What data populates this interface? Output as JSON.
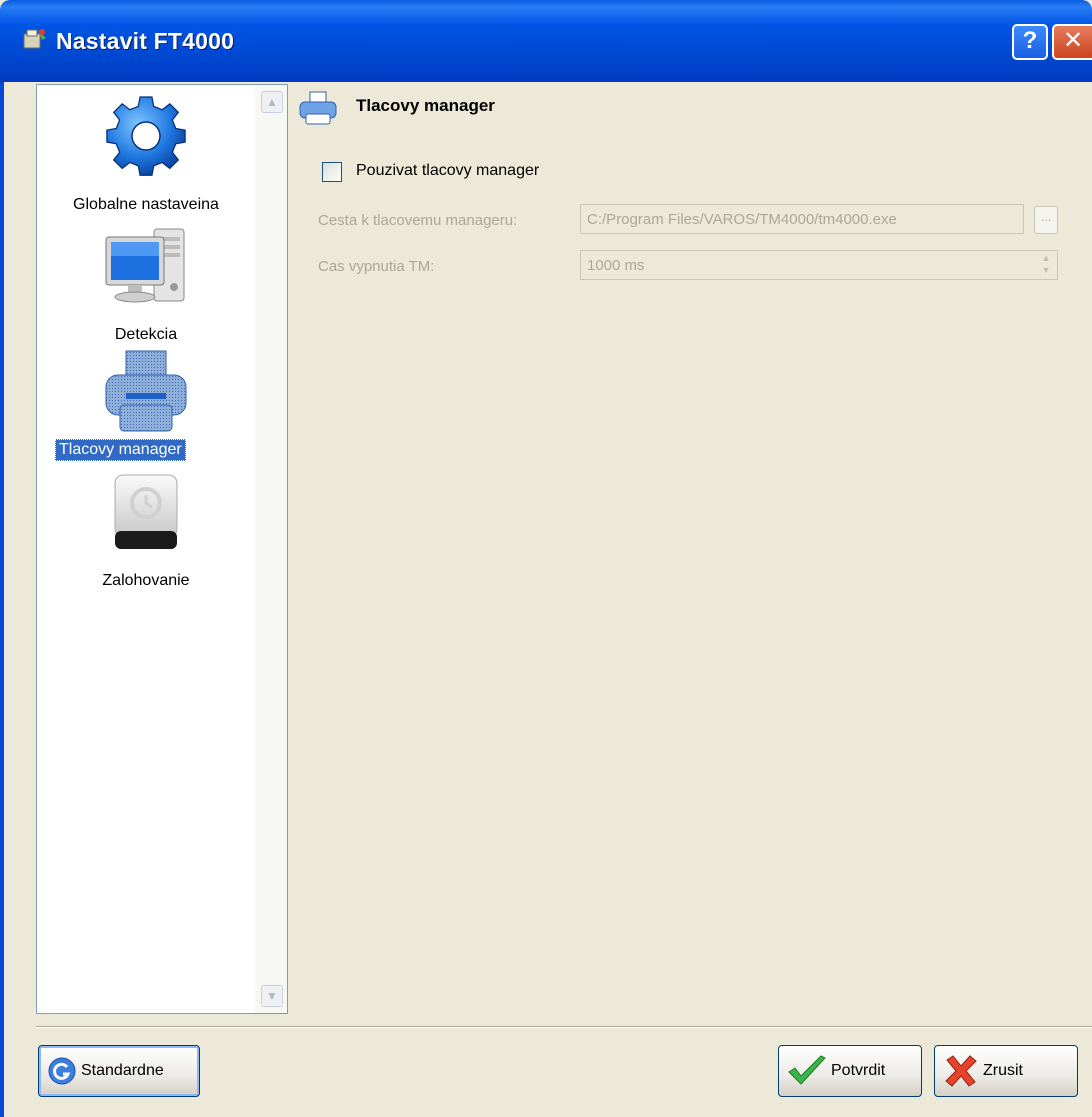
{
  "window": {
    "title": "Nastavit FT4000",
    "help_label": "?",
    "close_label": "✕"
  },
  "nav": {
    "items": [
      {
        "label": "Globalne nastaveina",
        "icon": "gear-icon",
        "selected": false
      },
      {
        "label": "Detekcia",
        "icon": "computer-icon",
        "selected": false
      },
      {
        "label": "Tlacovy manager",
        "icon": "printer-icon",
        "selected": true
      },
      {
        "label": "Zalohovanie",
        "icon": "backup-drive-icon",
        "selected": false
      }
    ]
  },
  "section": {
    "title": "Tlacovy manager",
    "icon": "printer-icon"
  },
  "form": {
    "use_manager_label": "Pouzivat tlacovy manager",
    "use_manager_checked": false,
    "path_label": "Cesta k tlacovemu manageru:",
    "path_value": "C:/Program Files/VAROS/TM4000/tm4000.exe",
    "browse_label": "...",
    "timeout_label": "Cas vypnutia TM:",
    "timeout_value": "1000 ms"
  },
  "buttons": {
    "defaults_label": "Standardne",
    "confirm_label": "Potvrdit",
    "cancel_label": "Zrusit"
  }
}
